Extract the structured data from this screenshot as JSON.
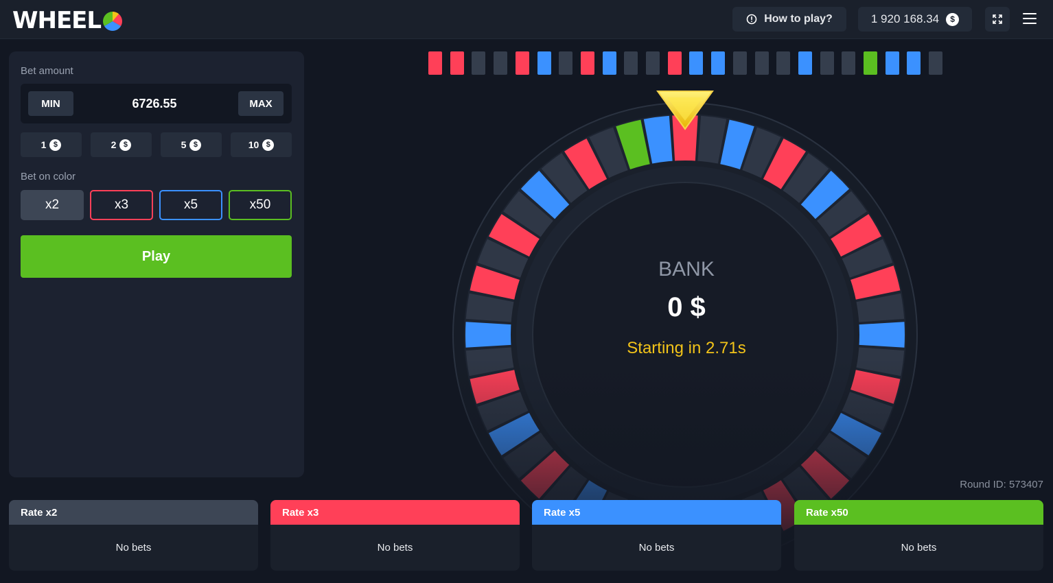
{
  "header": {
    "logo_text": "WHEEL",
    "how_to_play": "How to play?",
    "balance": "1 920 168.34",
    "currency_symbol": "$"
  },
  "bet_panel": {
    "bet_amount_label": "Bet amount",
    "min_label": "MIN",
    "max_label": "MAX",
    "bet_value": "6726.55",
    "chips": [
      "1",
      "2",
      "5",
      "10"
    ],
    "bet_on_color_label": "Bet on color",
    "color_options": [
      {
        "label": "x2",
        "color": "#3d4655"
      },
      {
        "label": "x3",
        "color": "#ff4058"
      },
      {
        "label": "x5",
        "color": "#3b91ff"
      },
      {
        "label": "x50",
        "color": "#5bbf21"
      }
    ],
    "play_label": "Play"
  },
  "history": [
    "red",
    "red",
    "gray",
    "gray",
    "red",
    "blue",
    "gray",
    "red",
    "blue",
    "gray",
    "gray",
    "red",
    "blue",
    "blue",
    "gray",
    "gray",
    "gray",
    "blue",
    "gray",
    "gray",
    "green",
    "blue",
    "blue",
    "gray"
  ],
  "colors": {
    "red": "#ff4058",
    "blue": "#3b91ff",
    "green": "#5bbf21",
    "gray": "#353e4d",
    "accent_yellow": "#f2c319"
  },
  "wheel": {
    "bank_label": "BANK",
    "bank_value": "0 $",
    "status": "Starting in 2.71s",
    "round_id": "Round ID: 573407",
    "segments": [
      "red",
      "gray",
      "blue",
      "gray",
      "red",
      "gray",
      "blue",
      "gray",
      "red",
      "gray",
      "red",
      "gray",
      "blue",
      "gray",
      "red",
      "gray",
      "red",
      "gray",
      "blue",
      "gray",
      "red",
      "gray",
      "blue",
      "gray",
      "red",
      "gray",
      "blue",
      "gray",
      "red",
      "gray",
      "red",
      "gray",
      "blue",
      "gray",
      "red",
      "gray",
      "green",
      "blue",
      "red",
      "gray",
      "blue",
      "gray",
      "red",
      "gray",
      "blue",
      "gray",
      "red",
      "gray"
    ]
  },
  "rates": [
    {
      "title": "Rate x2",
      "status": "No bets",
      "color": "#3d4655"
    },
    {
      "title": "Rate x3",
      "status": "No bets",
      "color": "#ff4058"
    },
    {
      "title": "Rate x5",
      "status": "No bets",
      "color": "#3b91ff"
    },
    {
      "title": "Rate x50",
      "status": "No bets",
      "color": "#5bbf21"
    }
  ]
}
